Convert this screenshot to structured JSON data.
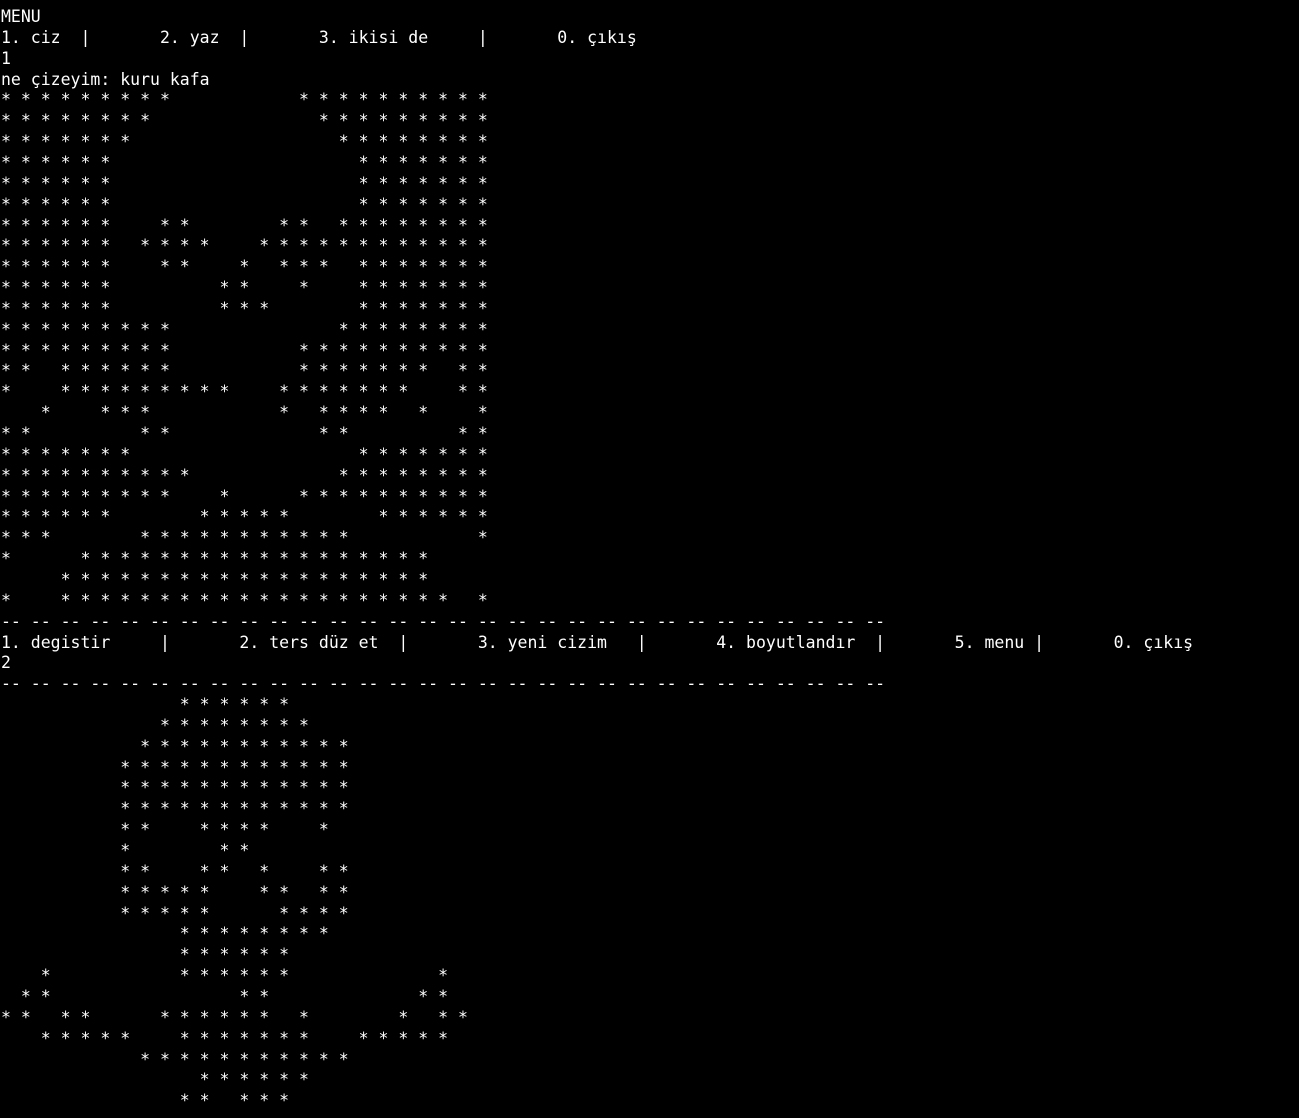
{
  "terminal": {
    "lines": [
      "MENU",
      "1. ciz  |       2. yaz  |       3. ikisi de     |       0. çıkış",
      "1",
      "ne çizeyim: kuru kafa",
      "* * * * * * * * *             * * * * * * * * * *",
      "* * * * * * * *                 * * * * * * * * *",
      "* * * * * * *                     * * * * * * * *",
      "* * * * * *                         * * * * * * *",
      "* * * * * *                         * * * * * * *",
      "* * * * * *                         * * * * * * *",
      "* * * * * *     * *         * *   * * * * * * * *",
      "* * * * * *   * * * *     * * * * * * * * * * * *",
      "* * * * * *     * *     *   * * *   * * * * * * *",
      "* * * * * *           * *     *     * * * * * * *",
      "* * * * * *           * * *         * * * * * * *",
      "* * * * * * * * *                 * * * * * * * *",
      "* * * * * * * * *             * * * * * * * * * *",
      "* *   * * * * * *             * * * * * * *   * *",
      "*     * * * * * * * * *     * * * * * * *     * *",
      "    *     * * *             *   * * * *   *     *",
      "* *           * *               * *           * *",
      "* * * * * * *                       * * * * * * *",
      "* * * * * * * * * *               * * * * * * * *",
      "* * * * * * * * *     *       * * * * * * * * * *",
      "* * * * * *         * * * * *         * * * * * *",
      "* * *         * * * * * * * * * * *             *",
      "*       * * * * * * * * * * * * * * * * * *",
      "      * * * * * * * * * * * * * * * * * * *",
      "*     * * * * * * * * * * * * * * * * * * * *   *",
      "-- -- -- -- -- -- -- -- -- -- -- -- -- -- -- -- -- -- -- -- -- -- -- -- -- -- -- -- -- --",
      "1. degistir     |       2. ters düz et  |       3. yeni cizim   |       4. boyutlandır  |       5. menu |       0. çıkış",
      "2",
      "-- -- -- -- -- -- -- -- -- -- -- -- -- -- -- -- -- -- -- -- -- -- -- -- -- -- -- -- -- --",
      "                  * * * * * *",
      "                * * * * * * * *",
      "              * * * * * * * * * * *",
      "            * * * * * * * * * * * *",
      "            * * * * * * * * * * * *",
      "            * * * * * * * * * * * *",
      "            * *     * * * *     *",
      "            *         * *",
      "            * *     * *   *     * *",
      "            * * * * *     * *   * *",
      "            * * * * *       * * * *",
      "                  * * * * * * * *",
      "                  * * * * * *",
      "    *             * * * * * *               *",
      "  * *                   * *               * *",
      "* *   * *       * * * * * *   *         *   * *",
      "    * * * * *     * * * * * * *     * * * * *",
      "              * * * * * * * * * * *",
      "                    * * * * * *",
      "                  * *   * * *"
    ]
  }
}
